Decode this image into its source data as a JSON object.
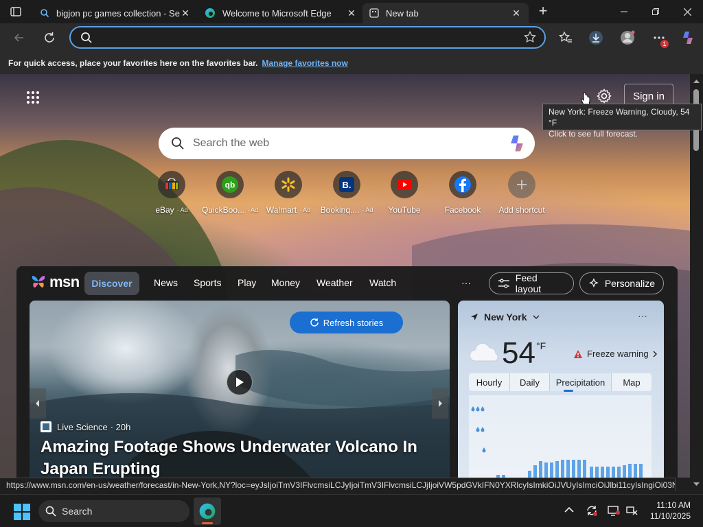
{
  "tabs": [
    {
      "title": "bigjon pc games collection - Search",
      "icon": "search-icon"
    },
    {
      "title": "Welcome to Microsoft Edge",
      "icon": "edge-icon"
    },
    {
      "title": "New tab",
      "icon": "newtab-icon"
    }
  ],
  "address_bar": {
    "value": "",
    "placeholder": ""
  },
  "toolbar": {
    "extensions_badge": "1"
  },
  "favorites_bar": {
    "message": "For quick access, place your favorites here on the favorites bar.",
    "link": "Manage favorites now"
  },
  "newtab": {
    "signin_label": "Sign in",
    "tooltip_line1": "New York: Freeze Warning, Cloudy, 54 °F",
    "tooltip_line2": "Click to see full forecast.",
    "search_placeholder": "Search the web",
    "shortcuts": [
      {
        "label": "eBay",
        "ad": "· Ad",
        "icon": "ebay-icon"
      },
      {
        "label": "QuickBoo...",
        "ad": "· Ad",
        "icon": "quickbooks-icon"
      },
      {
        "label": "Walmart",
        "ad": "· Ad",
        "icon": "walmart-icon"
      },
      {
        "label": "Bookinq....",
        "ad": "· Ad",
        "icon": "booking-icon"
      },
      {
        "label": "YouTube",
        "ad": "",
        "icon": "youtube-icon"
      },
      {
        "label": "Facebook",
        "ad": "",
        "icon": "facebook-icon"
      },
      {
        "label": "Add shortcut",
        "ad": "",
        "icon": "plus-icon"
      }
    ]
  },
  "feed": {
    "brand": "msn",
    "tabs": [
      "Discover",
      "News",
      "Sports",
      "Play",
      "Money",
      "Weather",
      "Watch"
    ],
    "more": "···",
    "feed_layout": "Feed layout",
    "personalize": "Personalize",
    "refresh": "Refresh stories",
    "source": "Live Science",
    "time": "· 20h",
    "headline": "Amazing Footage Shows Underwater Volcano In Japan Erupting"
  },
  "weather": {
    "location": "New York",
    "temp": "54",
    "unit": "°F",
    "alert": "Freeze warning",
    "more": "···",
    "tabs": [
      "Hourly",
      "Daily",
      "Precipitation",
      "Map"
    ],
    "active_tab": "Precipitation"
  },
  "status_url": "https://www.msn.com/en-us/weather/forecast/in-New-York,NY?loc=eyJsIjoiTmV3IFlvcmsiLCJyIjoiTmV3IFlvcmsiLCJjIjoiVW5pdGVkIFN0YXRlcyIsImkiOiJVUyIsImciOiJlbi11cyIsIngiOi03NC4...",
  "taskbar": {
    "search_label": "Search",
    "time": "11:10 AM",
    "date": "11/10/2025"
  },
  "colors": {
    "accent": "#1a6fd1",
    "address_border": "#5aa1e6",
    "link": "#6fb4f5",
    "alert": "#d13438"
  }
}
